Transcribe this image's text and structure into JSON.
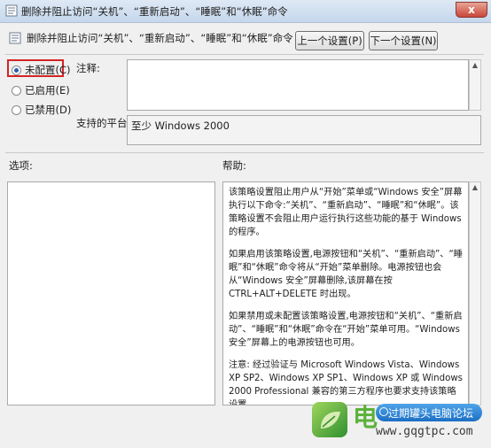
{
  "window": {
    "title": "删除并阻止访问“关机”、“重新启动”、“睡眠”和“休眠”命令",
    "close_glyph": "x"
  },
  "header": {
    "policy_name": "删除并阻止访问“关机”、“重新启动”、“睡眠”和“休眠”命令",
    "prev_button": "上一个设置(P)",
    "next_button": "下一个设置(N)"
  },
  "state": {
    "options": [
      {
        "label": "未配置(C)",
        "selected": true
      },
      {
        "label": "已启用(E)",
        "selected": false
      },
      {
        "label": "已禁用(D)",
        "selected": false
      }
    ],
    "highlight_color": "#d32424"
  },
  "fields": {
    "comment_label": "注释:",
    "comment_value": "",
    "platform_label": "支持的平台:",
    "platform_value": "至少 Windows 2000"
  },
  "panels": {
    "options_label": "选项:",
    "help_label": "帮助:",
    "help_paragraphs": [
      "该策略设置阻止用户从“开始”菜单或“Windows 安全”屏幕执行以下命令:“关机”、“重新启动”、“睡眠”和“休眠”。该策略设置不会阻止用户运行执行这些功能的基于 Windows 的程序。",
      "如果启用该策略设置,电源按钮和“关机”、“重新启动”、“睡眠”和“休眠”命令将从“开始”菜单删除。电源按钮也会从“Windows 安全”屏幕删除,该屏幕在按 CTRL+ALT+DELETE 时出现。",
      "如果禁用或未配置该策略设置,电源按钮和“关机”、“重新启动”、“睡眠”和“休眠”命令在“开始”菜单可用。“Windows 安全”屏幕上的电源按钮也可用。",
      "注意: 经过验证与 Microsoft Windows Vista、Windows XP SP2、Windows XP SP1、Windows XP 或 Windows 2000 Professional 兼容的第三方程序也要求支持该策略设置。"
    ]
  },
  "watermark": {
    "logo_char": "电",
    "site_name": "过期罐头电脑论坛",
    "url": "www.gqgtpc.com"
  }
}
